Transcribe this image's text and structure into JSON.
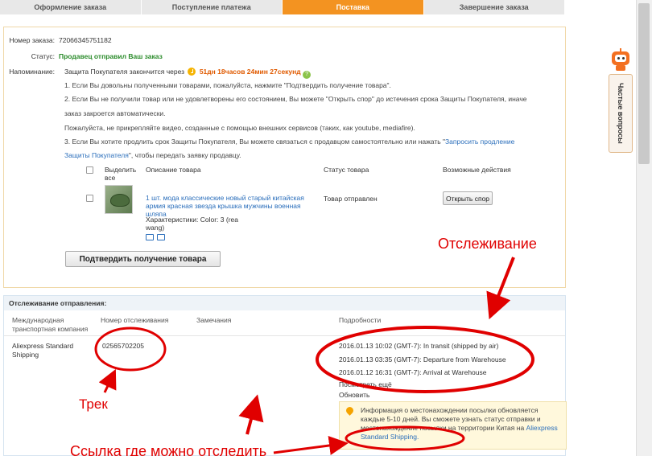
{
  "steps": [
    "Оформление заказа",
    "Поступление платежа",
    "Поставка",
    "Завершение заказа"
  ],
  "order": {
    "number_label": "Номер заказа:",
    "number": "72066345751182",
    "status_label": "Статус:",
    "status": "Продавец отправил Ваш заказ",
    "reminder_label": "Напоминание:",
    "reminder_prefix": "Защита Покупателя закончится через",
    "timer": "51дн 18часов 24мин 27секунд",
    "notes": [
      "1. Если Вы довольны полученными товарами, пожалуйста, нажмите \"Подтвердить получение товара\".",
      "2. Если Вы не получили товар или не удовлетворены его состоянием, Вы можете \"Открыть спор\" до истечения срока Защиты Покупателя, иначе",
      "заказ закроется автоматически.",
      "Пожалуйста, не прикрепляйте видео, созданные с помощью внешних сервисов (таких, как youtube, mediafire).",
      "3. Если Вы хотите продлить срок Защиты Покупателя, Вы можете связаться с продавцом самостоятельно или нажать \""
    ],
    "extend_link_1": "Запросить продление",
    "extend_link_2": "Защиты Покупателя",
    "extend_suffix": "\", чтобы передать заявку продавцу."
  },
  "items_table": {
    "select_all": "Выделить все",
    "col_description": "Описание товара",
    "col_status": "Статус товара",
    "col_actions": "Возможные действия",
    "item_title": "1 шт. мода классические новый старый китайская армия красная звезда крышка мужчины военная шляпа",
    "item_props": "Характеристики: Color: 3 (rea wang)",
    "item_status": "Товар отправлен",
    "open_dispute": "Открыть спор",
    "confirm_button": "Подтвердить получение товара"
  },
  "tracking": {
    "title": "Отслеживание отправления:",
    "col_carrier": "Международная транспортная компания",
    "col_number": "Номер отслеживания",
    "col_remarks": "Замечания",
    "col_details": "Подробности",
    "carrier": "Aliexpress Standard Shipping",
    "tracking_number": "02565702205",
    "events": [
      "2016.01.13 10:02 (GMT-7): In transit (shipped by air)",
      "2016.01.13 03:35 (GMT-7): Departure from Warehouse",
      "2016.01.12 16:31 (GMT-7): Arrival at Warehouse"
    ],
    "see_more": "Посмотреть ещё",
    "refresh": "Обновить",
    "info_text": "Информация о местонахождении посылки обновляется каждые 5-10 дней. Вы сможете узнать статус отправки и местонахождение посылки на территории Китая на",
    "info_link": "Aliexpress Standard Shipping."
  },
  "sidebar": {
    "faq": "Частые вопросы"
  },
  "annotations": {
    "tracking": "Отслеживание",
    "track": "Трек",
    "link_where": "Ссылка где можно отследить"
  }
}
